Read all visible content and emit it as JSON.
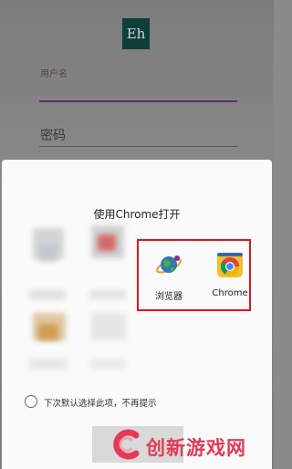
{
  "login": {
    "logo_text": "Eh",
    "username_label": "用户名",
    "password_placeholder": "密码"
  },
  "chooser": {
    "title": "使用Chrome打开",
    "apps": [
      {
        "label": "浏览器",
        "icon": "browser-icon"
      },
      {
        "label": "Chrome",
        "icon": "chrome-icon"
      }
    ],
    "default_option_label": "下次默认选择此项，不再提示",
    "highlight_color": "#d8191f"
  },
  "watermark": {
    "text": "创新游戏网",
    "color": "#e33b55"
  }
}
